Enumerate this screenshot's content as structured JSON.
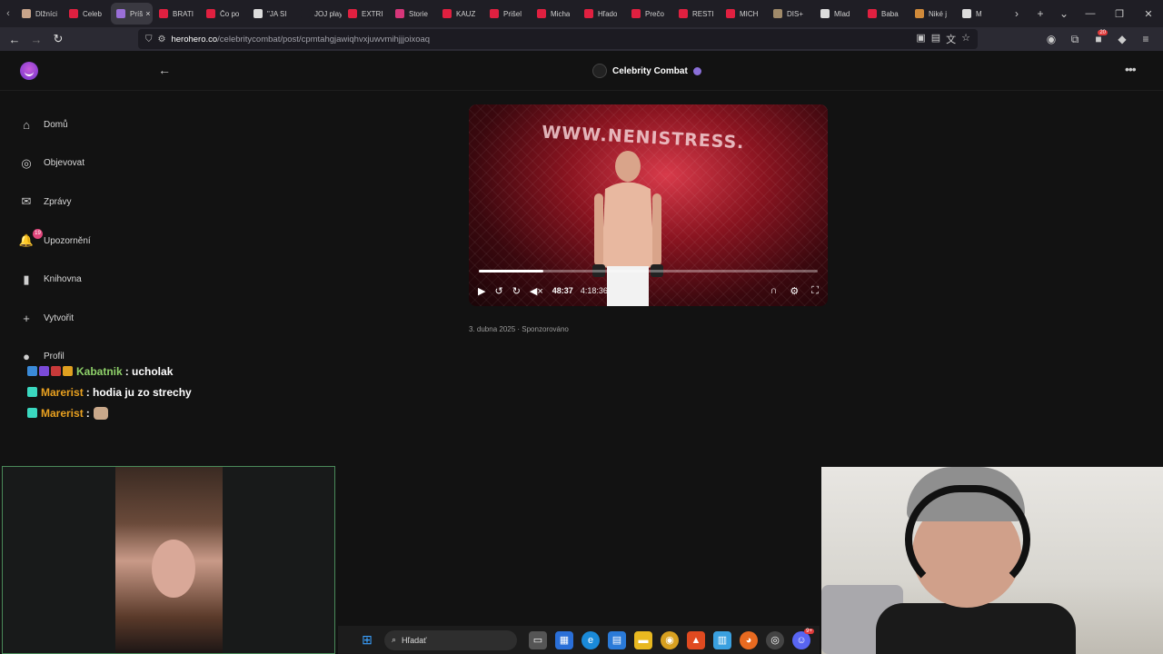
{
  "browser": {
    "tabs": [
      {
        "title": "Dlžníci",
        "color": "#c8a48a"
      },
      {
        "title": "Celeb",
        "color": "#e02040"
      },
      {
        "title": "Príš",
        "color": "#9a6fd8",
        "active": true
      },
      {
        "title": "BRATI",
        "color": "#e02040"
      },
      {
        "title": "Čo po",
        "color": "#e02040"
      },
      {
        "title": "\"JA SI",
        "color": "#ddd"
      },
      {
        "title": "JOJ play",
        "color": "#1f1e25"
      },
      {
        "title": "EXTRI",
        "color": "#e02040"
      },
      {
        "title": "Storie",
        "color": "#d6367a"
      },
      {
        "title": "KAUZ",
        "color": "#e02040"
      },
      {
        "title": "Prišel",
        "color": "#e02040"
      },
      {
        "title": "Micha",
        "color": "#e02040"
      },
      {
        "title": "Hľado",
        "color": "#e02040"
      },
      {
        "title": "Prečo",
        "color": "#e02040"
      },
      {
        "title": "RESTI",
        "color": "#e02040"
      },
      {
        "title": "MICH",
        "color": "#e02040"
      },
      {
        "title": "DIS+",
        "color": "#a08a6a"
      },
      {
        "title": "Mlad",
        "color": "#ddd"
      },
      {
        "title": "Baba",
        "color": "#e02040"
      },
      {
        "title": "Niké j",
        "color": "#d08a3a"
      },
      {
        "title": "M",
        "color": "#ddd"
      }
    ],
    "tab_close": "×",
    "new_tab": "+",
    "url_host": "herohero.co",
    "url_path": "/celebritycombat/post/cpmtahgjawiqhvxjuwvmihjjjoixoaq",
    "ext_badge": "20"
  },
  "app": {
    "creator_name": "Celebrity Combat",
    "nav": [
      {
        "label": "Domů",
        "icon": "home-icon",
        "glyph": "⌂"
      },
      {
        "label": "Objevovat",
        "icon": "compass-icon",
        "glyph": "◎"
      },
      {
        "label": "Zprávy",
        "icon": "mail-icon",
        "glyph": "✉"
      },
      {
        "label": "Upozornění",
        "icon": "bell-icon",
        "glyph": "🔔",
        "badge": "19"
      },
      {
        "label": "Knihovna",
        "icon": "bookmark-icon",
        "glyph": "▮"
      },
      {
        "label": "Vytvořit",
        "icon": "plus-icon",
        "glyph": "+"
      },
      {
        "label": "Profil",
        "icon": "user-icon",
        "glyph": "●"
      }
    ],
    "video": {
      "banner_text": "WWW.NENISTRESS.",
      "current_time": "48:37",
      "duration": "4:18:36",
      "progress_fraction": 0.19
    },
    "post_meta": "3. dubna 2025 · Sponzorováno"
  },
  "chat": [
    {
      "user": "Kabatnik",
      "user_color": "#8fd16a",
      "message": ": ucholak",
      "badges": [
        "#3a8ad8",
        "#7a4ad8",
        "#c83a3a",
        "#e0a020"
      ]
    },
    {
      "user": "Marerist",
      "user_color": "#e8a020",
      "message": ": hodia ju zo strechy",
      "badges": [
        "#3ad8c0"
      ]
    },
    {
      "user": "Marerist",
      "user_color": "#e8a020",
      "message": " :",
      "badges": [
        "#3ad8c0"
      ],
      "emote": true
    }
  ],
  "taskbar": {
    "search_placeholder": "Hľadať",
    "discord_badge": "9+"
  }
}
